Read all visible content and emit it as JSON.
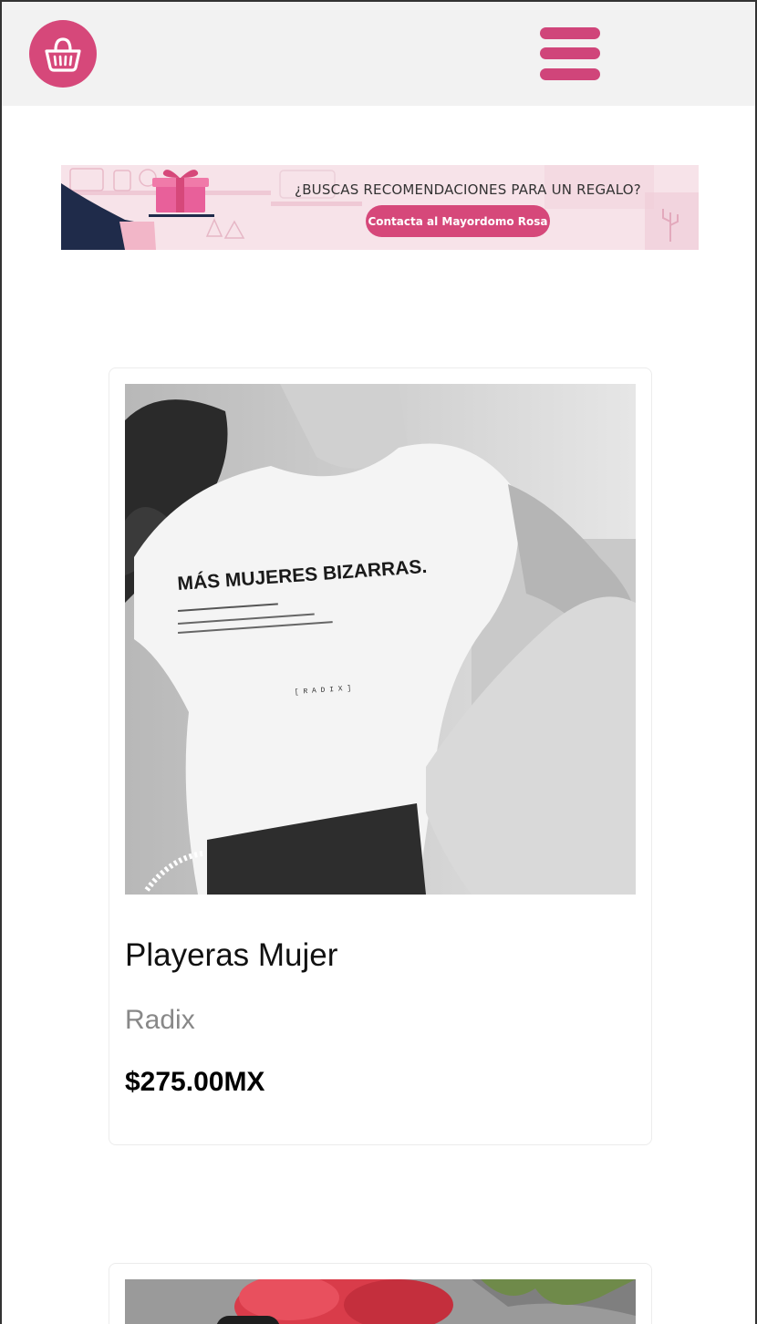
{
  "header": {
    "logo_icon": "basket-icon",
    "menu_icon": "hamburger-menu-icon",
    "accent_color": "#d6487a"
  },
  "banner": {
    "headline": "¿BUSCAS RECOMENDACIONES PARA UN REGALO?",
    "button_label": "Contacta al Mayordomo Rosa",
    "background_color": "#f7e3e9"
  },
  "products": [
    {
      "title": "Playeras Mujer",
      "brand": "Radix",
      "price": "$275.00MX",
      "image": {
        "shirt_print_title": "MÁS MUJERES BIZARRAS.",
        "shirt_print_brand": "[ R A D I X ]"
      }
    },
    {
      "image": {}
    }
  ]
}
